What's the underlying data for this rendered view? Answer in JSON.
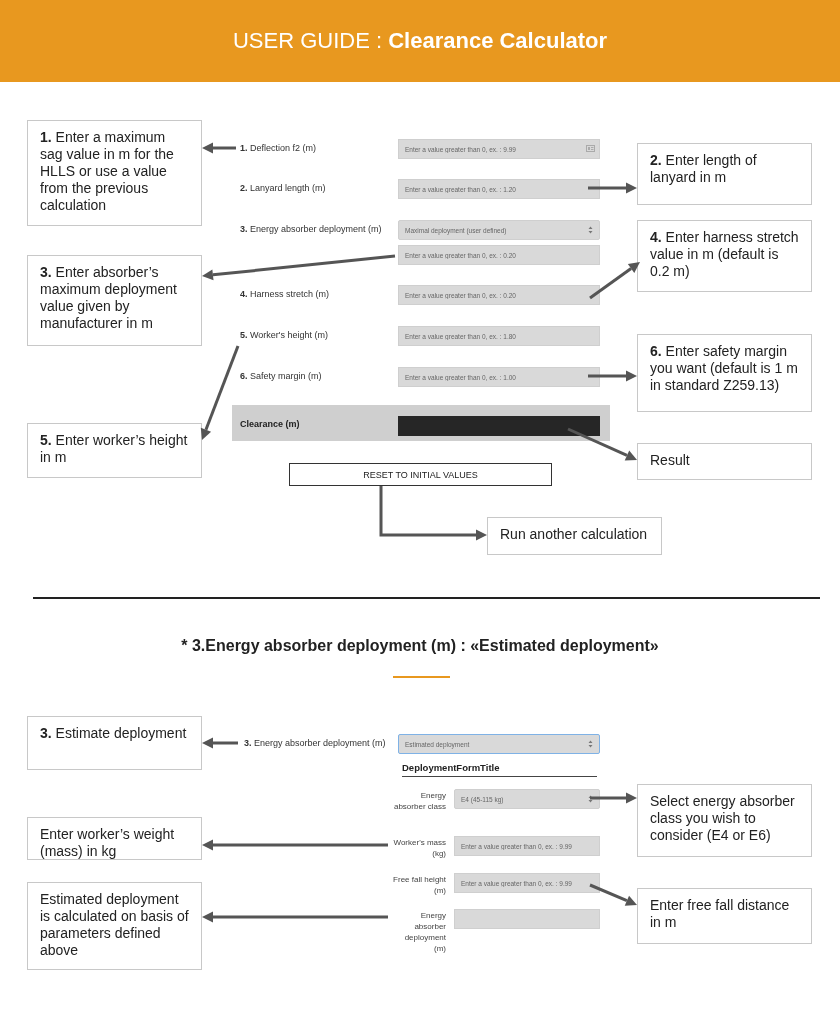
{
  "header": {
    "title": "USER GUIDE : **Clearance Calculator**"
  },
  "calculator": {
    "fields": [
      {
        "number": "1.",
        "label": "Deflection f2 (m)",
        "kind": "input",
        "placeholder": "Enter a value greater than 0, ex. : 9.99",
        "has_icon": true
      },
      {
        "number": "2.",
        "label": "Lanyard length (m)",
        "kind": "input",
        "placeholder": "Enter a value greater than 0, ex. : 1.20",
        "has_icon": false
      },
      {
        "number": "3.",
        "label": "Energy absorber deployment (m)",
        "kind": "select",
        "value": "Maximal deployment (user defined)"
      },
      {
        "kind": "input",
        "placeholder": "Enter a value greater than 0, ex. : 0.20",
        "has_icon": false
      },
      {
        "number": "4.",
        "label": "Harness stretch (m)",
        "kind": "input",
        "placeholder": "Enter a value greater than 0, ex. : 0.20",
        "has_icon": false
      },
      {
        "number": "5.",
        "label": "Worker's height (m)",
        "kind": "input",
        "placeholder": "Enter a value greater than 0, ex. : 1.80",
        "has_icon": false
      },
      {
        "number": "6.",
        "label": "Safety margin (m)",
        "kind": "input",
        "placeholder": "Enter a value greater than 0, ex. : 1.00",
        "has_icon": false
      }
    ],
    "result": {
      "label": "Clearance (m)"
    },
    "reset_button": "RESET TO INITIAL VALUES",
    "callouts": [
      "**1.** Enter a maximum sag value in m for the HLLS or use a value from the previous calculation",
      "**3.** Enter absorber’s maximum deployment value given by manufacturer in m",
      "**5.** Enter worker’s height in m",
      "**2.** Enter length of lanyard in m",
      "**4.** Enter harness stretch value in m (default is 0.2 m)",
      "**6.** Enter safety margin you want (default is 1 m in standard Z259.13)",
      "Result",
      "Run another calculation"
    ]
  },
  "section_heading": "* 3.Energy absorber deployment (m) :  «Estimated deployment»",
  "deployment": {
    "number": "3.",
    "label": "Energy absorber deployment (m)",
    "select": {
      "value": "Estimated deployment",
      "focused": true
    },
    "form_title": "DeploymentFormTitle",
    "fields": [
      {
        "label": "Energy absorber class",
        "kind": "select",
        "value": "E4 (45-115 kg)"
      },
      {
        "label": "Worker's mass (kg)",
        "kind": "input",
        "placeholder": "Enter a value greater than 0, ex. : 9.99"
      },
      {
        "label": "Free fall height (m)",
        "kind": "input",
        "placeholder": "Enter a value greater than 0, ex. : 9.99"
      },
      {
        "label": "Energy absorber deployment (m)",
        "kind": "output"
      }
    ],
    "callouts": [
      "**3.** Estimate deployment",
      "Enter worker’s weight (mass) in kg",
      "Estimated deployment is calculated on basis of parameters defined above",
      "Select energy absorber class you wish to consider (E4 or E6)",
      "Enter free fall distance in m"
    ]
  }
}
